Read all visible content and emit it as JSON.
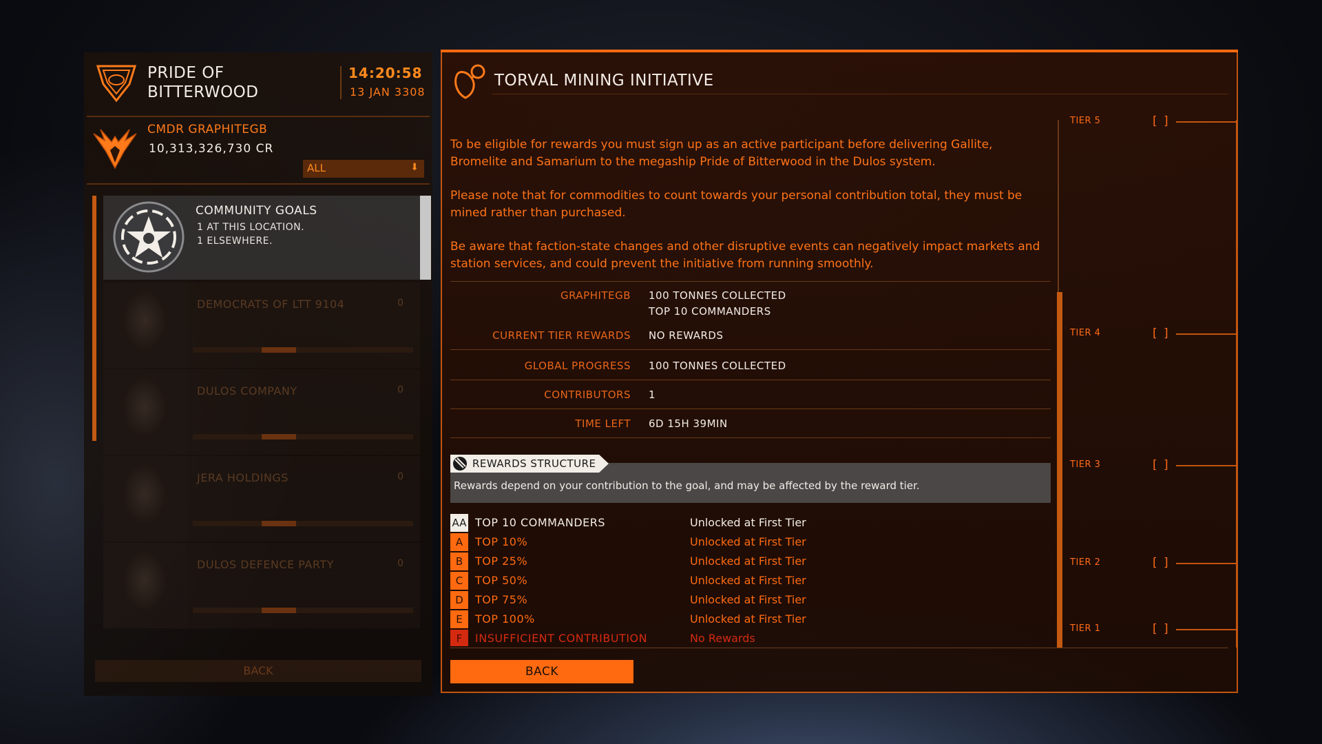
{
  "station": {
    "name_line1": "PRIDE OF",
    "name_line2": "BITTERWOOD",
    "time": "14:20:58",
    "date": "13 JAN 3308"
  },
  "commander": {
    "name": "CMDR GRAPHITEGB",
    "credits": "10,313,326,730 CR"
  },
  "filter": {
    "value": "ALL"
  },
  "list": {
    "community_goals": {
      "title": "COMMUNITY GOALS",
      "line1": "1 AT THIS LOCATION.",
      "line2": "1 ELSEWHERE."
    },
    "factions": [
      {
        "name": "DEMOCRATS OF LTT 9104",
        "value": "0"
      },
      {
        "name": "DULOS COMPANY",
        "value": "0"
      },
      {
        "name": "JERA HOLDINGS",
        "value": "0"
      },
      {
        "name": "DULOS DEFENCE PARTY",
        "value": "0"
      }
    ],
    "back_label": "BACK"
  },
  "goal": {
    "title": "TORVAL MINING INITIATIVE",
    "paragraphs": [
      "To be eligible for rewards you must sign up as an active participant before delivering Gallite, Bromelite and Samarium to the megaship Pride of Bitterwood in the Dulos system.",
      "Please note that for commodities to count towards your personal contribution total, they must be mined rather than purchased.",
      "Be aware that faction-state changes and other disruptive events can negatively impact markets and station services, and could prevent the initiative from running smoothly."
    ],
    "info": {
      "cmdr_label": "GRAPHITEGB",
      "cmdr_value1": "100 TONNES COLLECTED",
      "cmdr_value2": "TOP 10 COMMANDERS",
      "tier_rewards_label": "CURRENT TIER REWARDS",
      "tier_rewards_value": "NO REWARDS",
      "global_label": "GLOBAL PROGRESS",
      "global_value": "100 TONNES COLLECTED",
      "contributors_label": "CONTRIBUTORS",
      "contributors_value": "1",
      "time_left_label": "TIME LEFT",
      "time_left_value": "6D 15H 39MIN"
    },
    "rewards": {
      "header": "REWARDS STRUCTURE",
      "description": "Rewards depend on your contribution to the goal, and may be affected by the reward tier.",
      "tiers": [
        {
          "badge": "AA",
          "label": "TOP 10 COMMANDERS",
          "value": "Unlocked at First Tier"
        },
        {
          "badge": "A",
          "label": "TOP 10%",
          "value": "Unlocked at First Tier"
        },
        {
          "badge": "B",
          "label": "TOP 25%",
          "value": "Unlocked at First Tier"
        },
        {
          "badge": "C",
          "label": "TOP 50%",
          "value": "Unlocked at First Tier"
        },
        {
          "badge": "D",
          "label": "TOP 75%",
          "value": "Unlocked at First Tier"
        },
        {
          "badge": "E",
          "label": "TOP 100%",
          "value": "Unlocked at First Tier"
        },
        {
          "badge": "F",
          "label": "INSUFFICIENT CONTRIBUTION",
          "value": "No Rewards"
        }
      ]
    },
    "back_label": "BACK"
  },
  "ladder": {
    "tiers": [
      "TIER 5",
      "TIER 4",
      "TIER 3",
      "TIER 2",
      "TIER 1"
    ],
    "bracket": "[ ]"
  },
  "colors": {
    "accent": "#ff6a10",
    "text_light": "#f2ede6",
    "highlight_badge": "#f2ede6",
    "insufficient": "#d42a10"
  }
}
